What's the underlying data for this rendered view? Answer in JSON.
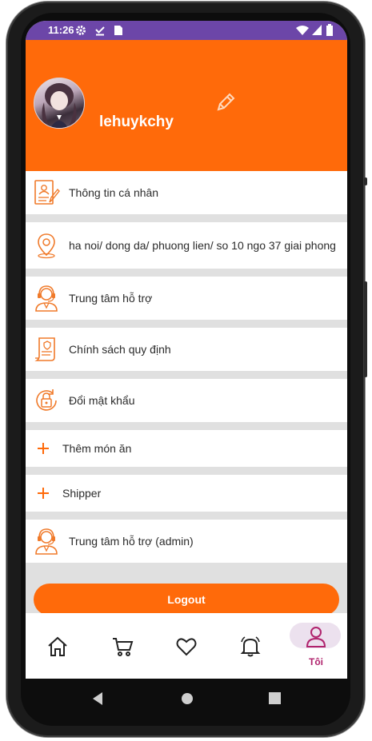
{
  "status_bar": {
    "time": "11:26"
  },
  "profile": {
    "username": "lehuykchy"
  },
  "menu": [
    {
      "label": "Thông tin cá nhân",
      "icon": "profile-document-icon"
    },
    {
      "label": "ha noi/ dong da/ phuong lien/ so 10 ngo 37 giai phong",
      "icon": "location-pin-icon"
    },
    {
      "label": "Trung tâm hỗ trợ",
      "icon": "support-agent-icon"
    },
    {
      "label": "Chính sách quy định",
      "icon": "policy-document-icon"
    },
    {
      "label": "Đổi mật khẩu",
      "icon": "lock-refresh-icon"
    },
    {
      "label": "Thêm món ăn",
      "icon": "plus-icon"
    },
    {
      "label": "Shipper",
      "icon": "plus-icon"
    },
    {
      "label": "Trung tâm hỗ trợ (admin)",
      "icon": "support-agent-icon"
    }
  ],
  "logout_label": "Logout",
  "nav": {
    "items": [
      "home-icon",
      "cart-icon",
      "heart-icon",
      "bell-icon",
      "user-icon"
    ],
    "active_label": "Tôi"
  },
  "colors": {
    "brand": "#ff6a0a",
    "status_bar": "#6c46a8",
    "nav_active": "#b0236d"
  }
}
